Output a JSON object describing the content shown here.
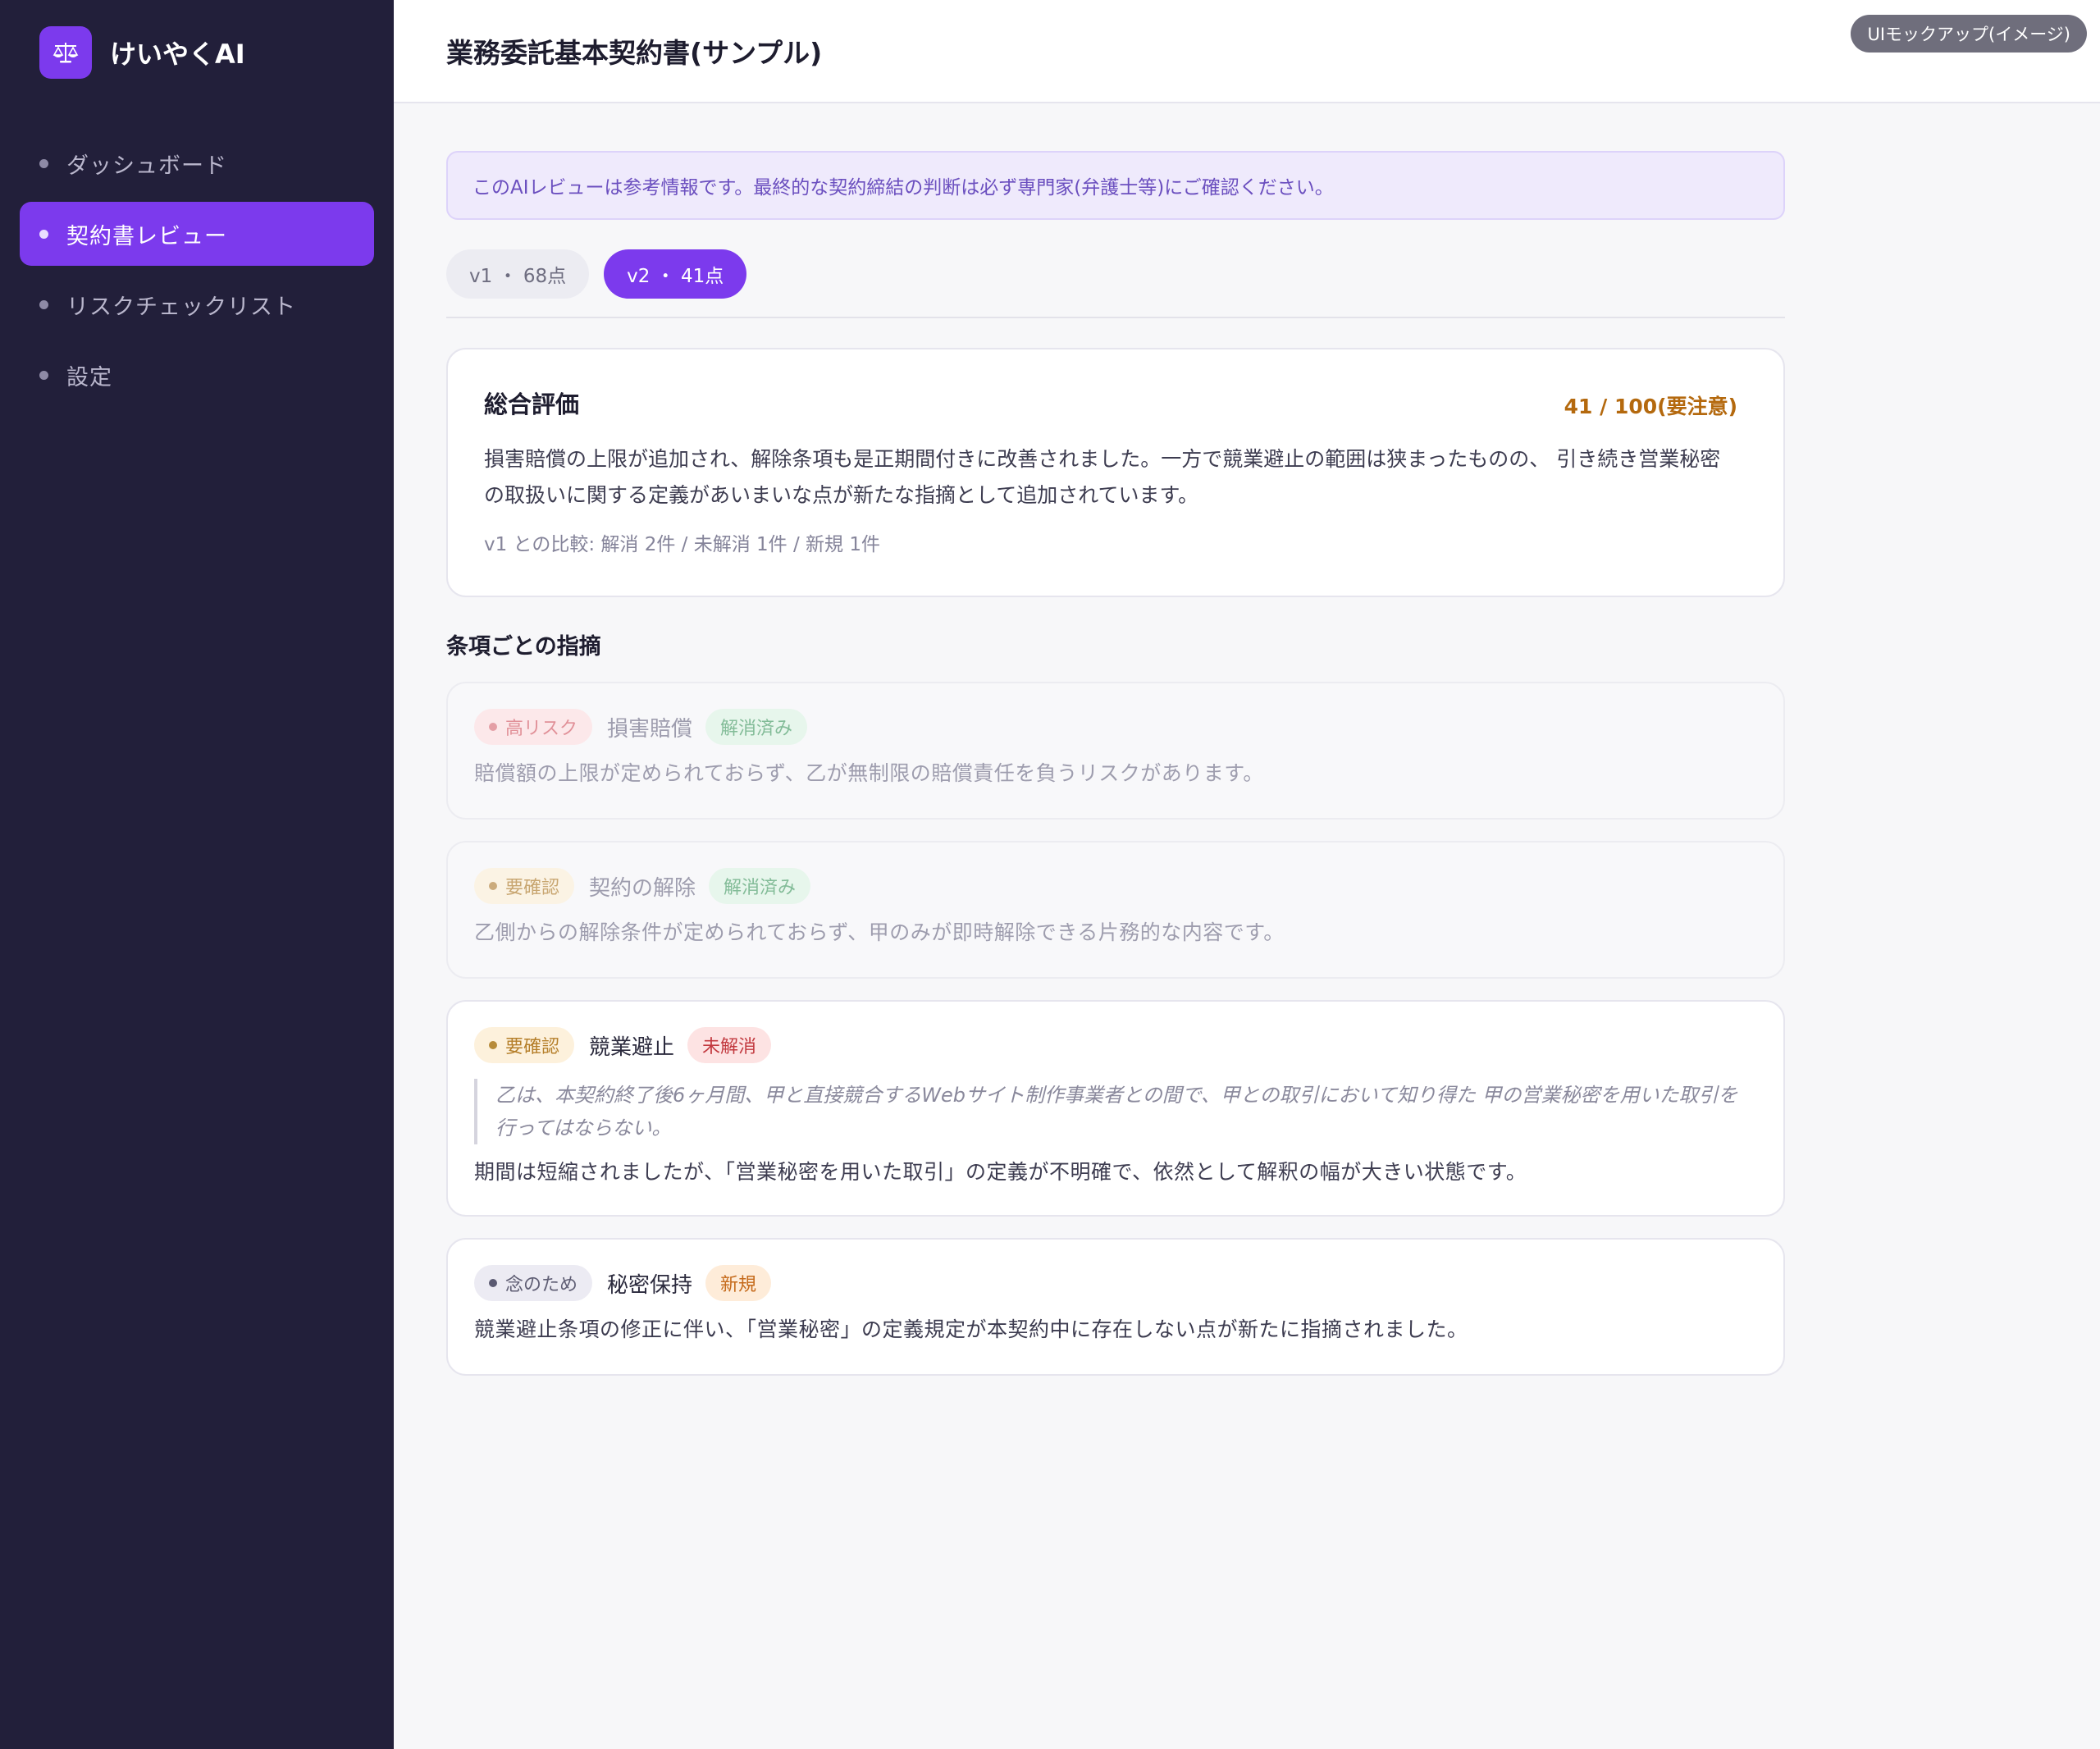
{
  "app": {
    "name": "けいやくAI"
  },
  "sidebar": {
    "items": [
      {
        "label": "ダッシュボード",
        "active": false
      },
      {
        "label": "契約書レビュー",
        "active": true
      },
      {
        "label": "リスクチェックリスト",
        "active": false
      },
      {
        "label": "設定",
        "active": false
      }
    ]
  },
  "header": {
    "title": "業務委託基本契約書(サンプル)",
    "badge": "UIモックアップ(イメージ)"
  },
  "notice": "このAIレビューは参考情報です。最終的な契約締結の判断は必ず専門家(弁護士等)にご確認ください。",
  "tabs": [
    {
      "label": "v1 ・ 68点",
      "active": false
    },
    {
      "label": "v2 ・ 41点",
      "active": true
    }
  ],
  "summary": {
    "title": "総合評価",
    "score": "41 / 100(要注意)",
    "body": "損害賠償の上限が追加され、解除条項も是正期間付きに改善されました。一方で競業避止の範囲は狭まったものの、 引き続き営業秘密の取扱いに関する定義があいまいな点が新たな指摘として追加されています。",
    "compare": "v1 との比較: 解消 2件 / 未解消 1件 / 新規 1件"
  },
  "issues_section": {
    "title": "条項ごとの指摘",
    "items": [
      {
        "risk": "高リスク",
        "clause": "損害賠償",
        "status": "解消済み",
        "description": "賠償額の上限が定められておらず、乙が無制限の賠償責任を負うリスクがあります。"
      },
      {
        "risk": "要確認",
        "clause": "契約の解除",
        "status": "解消済み",
        "description": "乙側からの解除条件が定められておらず、甲のみが即時解除できる片務的な内容です。"
      },
      {
        "risk": "要確認",
        "clause": "競業避止",
        "status": "未解消",
        "quote": "乙は、本契約終了後6ヶ月間、甲と直接競合するWebサイト制作事業者との間で、甲との取引において知り得た 甲の営業秘密を用いた取引を行ってはならない。",
        "description": "期間は短縮されましたが、「営業秘密を用いた取引」の定義が不明確で、依然として解釈の幅が大きい状態です。"
      },
      {
        "risk": "念のため",
        "clause": "秘密保持",
        "status": "新規",
        "description": "競業避止条項の修正に伴い、「営業秘密」の定義規定が本契約中に存在しない点が新たに指摘されました。"
      }
    ]
  },
  "colors": {
    "sidebar_bg": "#221f3a",
    "accent": "#7c3aed",
    "score": "#b4690e"
  },
  "icons": {
    "brand": "scales-icon"
  }
}
